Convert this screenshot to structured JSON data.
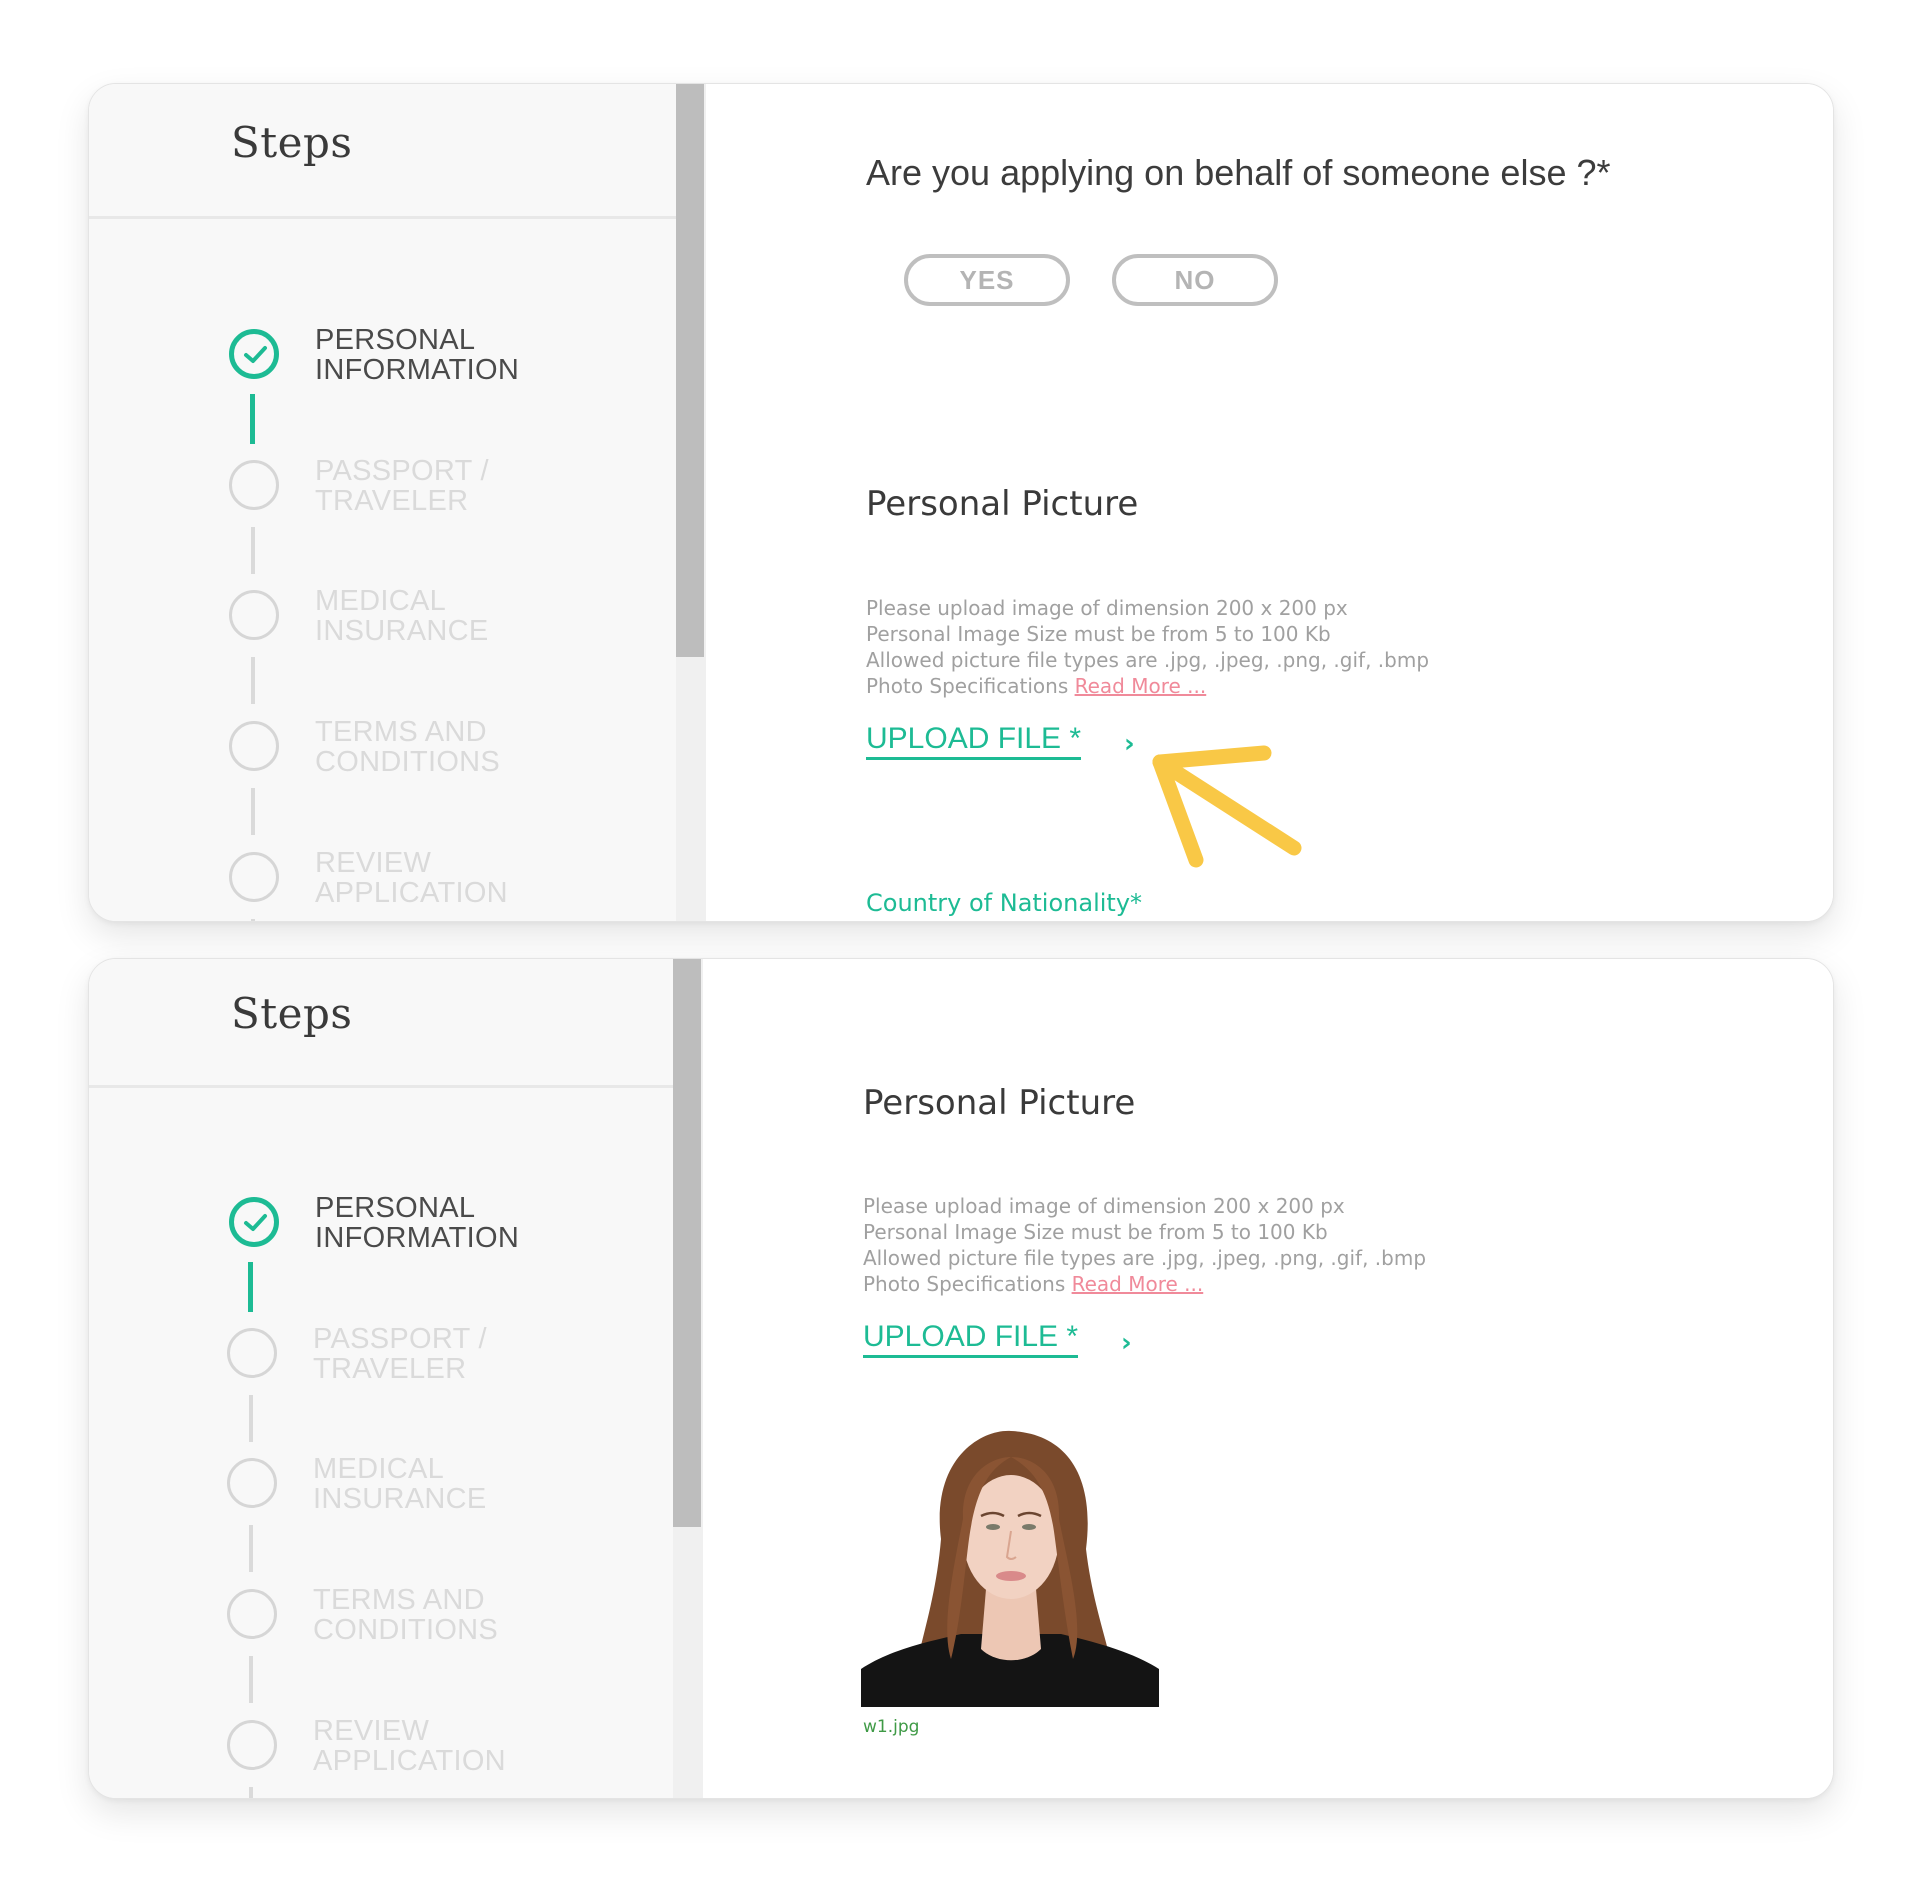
{
  "colors": {
    "accent": "#1dbb94",
    "link_pink": "#f08a9a",
    "highlight_arrow": "#f9c846",
    "inactive": "#dadada"
  },
  "panels": [
    {
      "sidebar": {
        "title": "Steps",
        "steps": [
          {
            "label_line1": "PERSONAL",
            "label_line2": "INFORMATION",
            "status": "completed",
            "icon": "check-circle-icon"
          },
          {
            "label_line1": "PASSPORT /",
            "label_line2": "TRAVELER",
            "status": "pending",
            "icon": "empty-circle-icon"
          },
          {
            "label_line1": "MEDICAL",
            "label_line2": "INSURANCE",
            "status": "pending",
            "icon": "empty-circle-icon"
          },
          {
            "label_line1": "TERMS AND",
            "label_line2": "CONDITIONS",
            "status": "pending",
            "icon": "empty-circle-icon"
          },
          {
            "label_line1": "REVIEW",
            "label_line2": "APPLICATION",
            "status": "pending",
            "icon": "empty-circle-icon"
          }
        ]
      },
      "main": {
        "question": "Are you applying on behalf of someone else ?*",
        "yes_label": "YES",
        "no_label": "NO",
        "picture_title": "Personal Picture",
        "hints": [
          "Please upload image of dimension 200 x 200 px",
          "Personal Image Size must be from 5 to 100 Kb",
          "Allowed picture file types are .jpg, .jpeg, .png, .gif, .bmp"
        ],
        "spec_prefix": "Photo Specifications ",
        "read_more": "Read More ...",
        "upload_label": "UPLOAD FILE *",
        "upload_chevron": "›",
        "country_label": "Country of Nationality*",
        "annotation": "yellow-arrow-pointing-to-upload"
      }
    },
    {
      "sidebar": {
        "title": "Steps",
        "steps": [
          {
            "label_line1": "PERSONAL",
            "label_line2": "INFORMATION",
            "status": "completed",
            "icon": "check-circle-icon"
          },
          {
            "label_line1": "PASSPORT /",
            "label_line2": "TRAVELER",
            "status": "pending",
            "icon": "empty-circle-icon"
          },
          {
            "label_line1": "MEDICAL",
            "label_line2": "INSURANCE",
            "status": "pending",
            "icon": "empty-circle-icon"
          },
          {
            "label_line1": "TERMS AND",
            "label_line2": "CONDITIONS",
            "status": "pending",
            "icon": "empty-circle-icon"
          },
          {
            "label_line1": "REVIEW",
            "label_line2": "APPLICATION",
            "status": "pending",
            "icon": "empty-circle-icon"
          }
        ]
      },
      "main": {
        "picture_title": "Personal Picture",
        "hints": [
          "Please upload image of dimension 200 x 200 px",
          "Personal Image Size must be from 5 to 100 Kb",
          "Allowed picture file types are .jpg, .jpeg, .png, .gif, .bmp"
        ],
        "spec_prefix": "Photo Specifications ",
        "read_more": "Read More ...",
        "upload_label": "UPLOAD FILE *",
        "upload_chevron": "›",
        "uploaded_file_name": "w1.jpg",
        "uploaded_image": "portrait-photo"
      }
    }
  ]
}
